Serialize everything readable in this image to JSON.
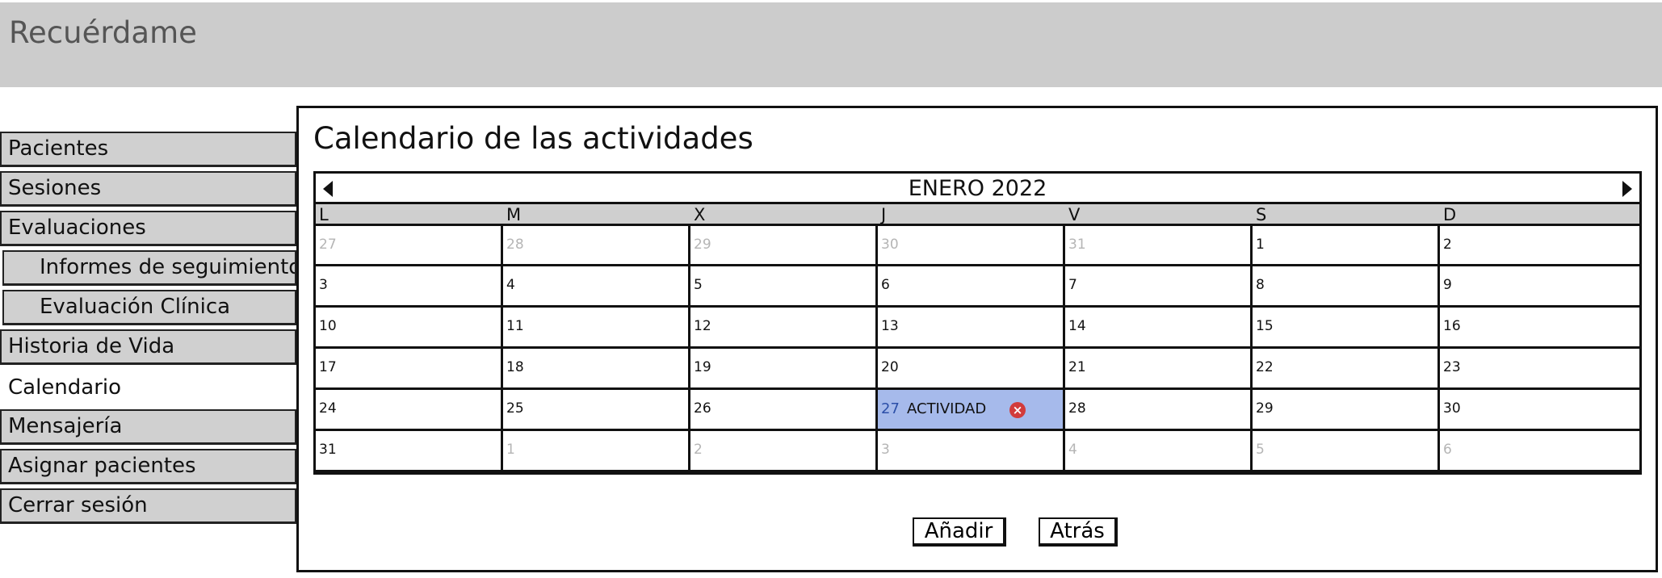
{
  "header": {
    "app_title": "Recuérdame"
  },
  "sidebar": {
    "items": [
      {
        "label": "Pacientes"
      },
      {
        "label": "Sesiones"
      },
      {
        "label": "Evaluaciones"
      },
      {
        "label": "Informes de seguimiento"
      },
      {
        "label": "Evaluación Clínica"
      },
      {
        "label": "Historia de Vida"
      },
      {
        "label": "Calendario"
      },
      {
        "label": "Mensajería"
      },
      {
        "label": "Asignar pacientes"
      },
      {
        "label": "Cerrar sesión"
      }
    ],
    "selected": "Calendario"
  },
  "main": {
    "title": "Calendario de las actividades",
    "calendar": {
      "month_label": "ENERO 2022",
      "weekdays": [
        "L",
        "M",
        "X",
        "J",
        "V",
        "S",
        "D"
      ],
      "weeks": [
        [
          "27",
          "28",
          "29",
          "30",
          "31",
          "1",
          "2"
        ],
        [
          "3",
          "4",
          "5",
          "6",
          "7",
          "8",
          "9"
        ],
        [
          "10",
          "11",
          "12",
          "13",
          "14",
          "15",
          "16"
        ],
        [
          "17",
          "18",
          "19",
          "20",
          "21",
          "22",
          "23"
        ],
        [
          "24",
          "25",
          "26",
          "27",
          "28",
          "29",
          "30"
        ],
        [
          "31",
          "1",
          "2",
          "3",
          "4",
          "5",
          "6"
        ]
      ],
      "outside_days": [
        [
          true,
          true,
          true,
          true,
          true,
          false,
          false
        ],
        [
          false,
          false,
          false,
          false,
          false,
          false,
          false
        ],
        [
          false,
          false,
          false,
          false,
          false,
          false,
          false
        ],
        [
          false,
          false,
          false,
          false,
          false,
          false,
          false
        ],
        [
          false,
          false,
          false,
          false,
          false,
          false,
          false
        ],
        [
          false,
          true,
          true,
          true,
          true,
          true,
          true
        ]
      ],
      "activity": {
        "week": 4,
        "day": 3,
        "label": "ACTIVIDAD"
      }
    },
    "buttons": {
      "add": "Añadir",
      "back": "Atrás"
    }
  },
  "colors": {
    "header_bg": "#cccccc",
    "sidebar_bg": "#d0d0d0",
    "activity_bg": "#a6baeb",
    "remove_icon": "#d23b3b",
    "outside_day_text": "#b5b5b5"
  }
}
